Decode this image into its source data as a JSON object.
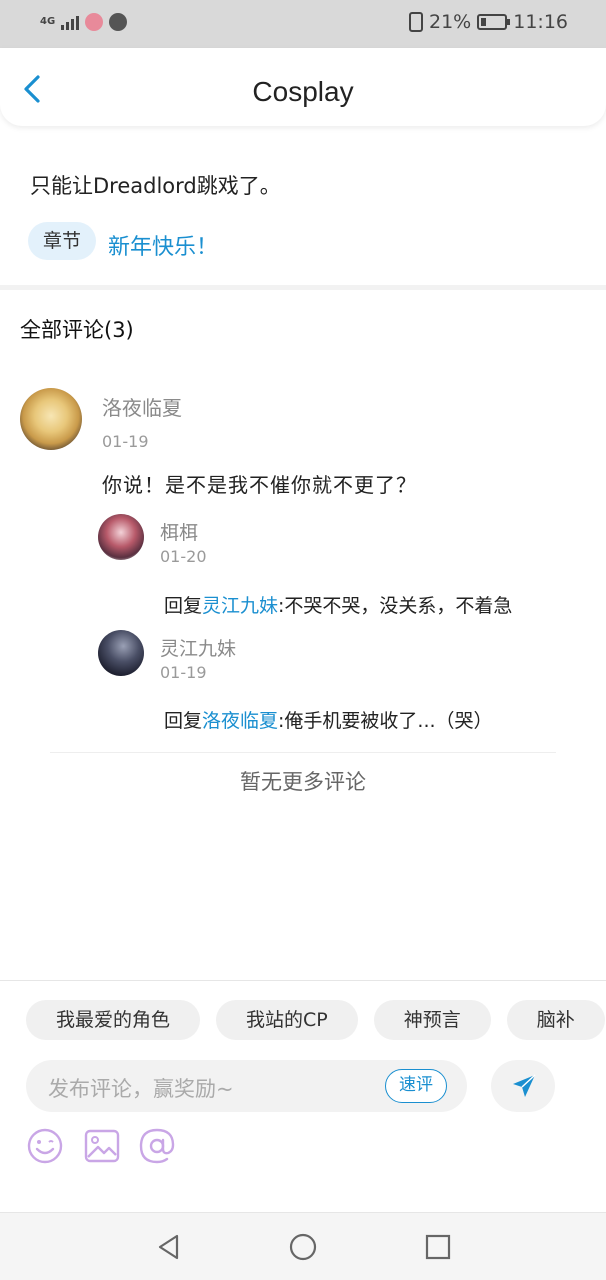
{
  "status_bar": {
    "network": "4G",
    "battery": "21%",
    "battery_level": 0.21,
    "time": "11:16"
  },
  "header": {
    "back_icon": "chevron-left-icon",
    "title": "Cosplay"
  },
  "post": {
    "text": "只能让Dreadlord跳戏了。",
    "chapter_tag": "章节",
    "chapter_title": "新年快乐！"
  },
  "comments": {
    "heading": "全部评论(3)",
    "items": [
      {
        "user": "洛夜临夏",
        "date": "01-19",
        "text": "你说！是不是我不催你就不更了？",
        "replies": [
          {
            "user": "栮栮",
            "date": "01-20",
            "prefix": "回复",
            "target": "灵江九妹",
            "text": ":不哭不哭，没关系，不着急"
          },
          {
            "user": "灵江九妹",
            "date": "01-19",
            "prefix": "回复",
            "target": "洛夜临夏",
            "text": ":俺手机要被收了...（哭）"
          }
        ]
      }
    ],
    "no_more": "暂无更多评论"
  },
  "composer": {
    "chips": [
      "我最爱的角色",
      "我站的CP",
      "神预言",
      "脑补"
    ],
    "placeholder": "发布评论，赢奖励~",
    "quick_label": "速评",
    "send_icon": "send-icon",
    "tools": [
      "emoji-icon",
      "image-icon",
      "mention-icon"
    ],
    "accent_color": "#1a8fd0",
    "tool_color": "#c9a6e6"
  },
  "nav": [
    "back-triangle-icon",
    "home-circle-icon",
    "recents-square-icon"
  ]
}
